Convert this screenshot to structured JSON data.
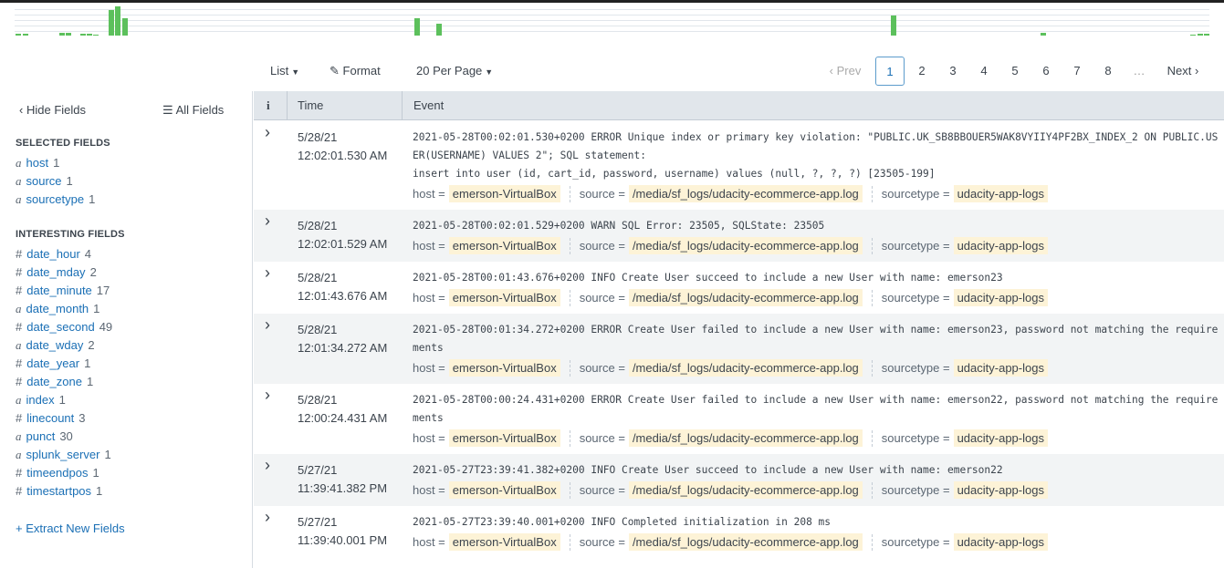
{
  "colors": {
    "accent": "#1a6fb5",
    "histogram": "#5cc05c",
    "highlight": "#fdf3d7"
  },
  "toolbar": {
    "list_label": "List",
    "format_label": "Format",
    "per_page_label": "20 Per Page",
    "format_icon": "pencil-icon",
    "caret_icon": "caret-down-icon"
  },
  "pager": {
    "prev_label": "Prev",
    "next_label": "Next",
    "pages": [
      "1",
      "2",
      "3",
      "4",
      "5",
      "6",
      "7",
      "8"
    ],
    "ellipsis": "…",
    "current_page": "1"
  },
  "sidebar": {
    "hide_fields_label": "Hide Fields",
    "all_fields_label": "All Fields",
    "selected_heading": "SELECTED FIELDS",
    "selected_fields": [
      {
        "type": "a",
        "name": "host",
        "count": "1"
      },
      {
        "type": "a",
        "name": "source",
        "count": "1"
      },
      {
        "type": "a",
        "name": "sourcetype",
        "count": "1"
      }
    ],
    "interesting_heading": "INTERESTING FIELDS",
    "interesting_fields": [
      {
        "type": "#",
        "name": "date_hour",
        "count": "4"
      },
      {
        "type": "#",
        "name": "date_mday",
        "count": "2"
      },
      {
        "type": "#",
        "name": "date_minute",
        "count": "17"
      },
      {
        "type": "a",
        "name": "date_month",
        "count": "1"
      },
      {
        "type": "#",
        "name": "date_second",
        "count": "49"
      },
      {
        "type": "a",
        "name": "date_wday",
        "count": "2"
      },
      {
        "type": "#",
        "name": "date_year",
        "count": "1"
      },
      {
        "type": "#",
        "name": "date_zone",
        "count": "1"
      },
      {
        "type": "a",
        "name": "index",
        "count": "1"
      },
      {
        "type": "#",
        "name": "linecount",
        "count": "3"
      },
      {
        "type": "a",
        "name": "punct",
        "count": "30"
      },
      {
        "type": "a",
        "name": "splunk_server",
        "count": "1"
      },
      {
        "type": "#",
        "name": "timeendpos",
        "count": "1"
      },
      {
        "type": "#",
        "name": "timestartpos",
        "count": "1"
      }
    ],
    "extract_label": "+ Extract New Fields"
  },
  "table": {
    "info_header": "i",
    "time_header": "Time",
    "event_header": "Event",
    "meta_keys": {
      "host": "host =",
      "source": "source =",
      "sourcetype": "sourcetype ="
    },
    "rows": [
      {
        "date": "5/28/21",
        "time": "12:02:01.530 AM",
        "event": "2021-05-28T00:02:01.530+0200 ERROR Unique index or primary key violation: \"PUBLIC.UK_SB8BBOUER5WAK8VYIIY4PF2BX_INDEX_2 ON PUBLIC.USER(USERNAME) VALUES 2\"; SQL statement:\ninsert into user (id, cart_id, password, username) values (null, ?, ?, ?) [23505-199]",
        "host": "emerson-VirtualBox",
        "source": "/media/sf_logs/udacity-ecommerce-app.log",
        "sourcetype": "udacity-app-logs"
      },
      {
        "date": "5/28/21",
        "time": "12:02:01.529 AM",
        "event": "2021-05-28T00:02:01.529+0200 WARN SQL Error: 23505, SQLState: 23505",
        "host": "emerson-VirtualBox",
        "source": "/media/sf_logs/udacity-ecommerce-app.log",
        "sourcetype": "udacity-app-logs"
      },
      {
        "date": "5/28/21",
        "time": "12:01:43.676 AM",
        "event": "2021-05-28T00:01:43.676+0200 INFO Create User succeed to include a new User with name: emerson23",
        "host": "emerson-VirtualBox",
        "source": "/media/sf_logs/udacity-ecommerce-app.log",
        "sourcetype": "udacity-app-logs"
      },
      {
        "date": "5/28/21",
        "time": "12:01:34.272 AM",
        "event": "2021-05-28T00:01:34.272+0200 ERROR Create User failed to include a new User with name: emerson23, password not matching the requirements",
        "host": "emerson-VirtualBox",
        "source": "/media/sf_logs/udacity-ecommerce-app.log",
        "sourcetype": "udacity-app-logs"
      },
      {
        "date": "5/28/21",
        "time": "12:00:24.431 AM",
        "event": "2021-05-28T00:00:24.431+0200 ERROR Create User failed to include a new User with name: emerson22, password not matching the requirements",
        "host": "emerson-VirtualBox",
        "source": "/media/sf_logs/udacity-ecommerce-app.log",
        "sourcetype": "udacity-app-logs"
      },
      {
        "date": "5/27/21",
        "time": "11:39:41.382 PM",
        "event": "2021-05-27T23:39:41.382+0200 INFO Create User succeed to include a new User with name: emerson22",
        "host": "emerson-VirtualBox",
        "source": "/media/sf_logs/udacity-ecommerce-app.log",
        "sourcetype": "udacity-app-logs"
      },
      {
        "date": "5/27/21",
        "time": "11:39:40.001 PM",
        "event": "2021-05-27T23:39:40.001+0200 INFO Completed initialization in 208 ms",
        "host": "emerson-VirtualBox",
        "source": "/media/sf_logs/udacity-ecommerce-app.log",
        "sourcetype": "udacity-app-logs"
      }
    ]
  }
}
